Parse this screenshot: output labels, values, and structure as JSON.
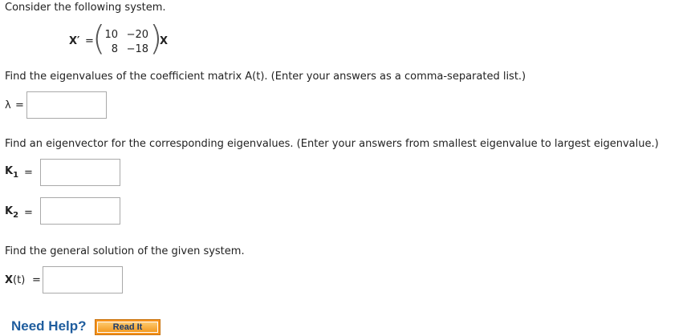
{
  "intro": "Consider the following system.",
  "system": {
    "lhs": "X′",
    "equals": "=",
    "matrix": [
      [
        "10",
        "−20"
      ],
      [
        "8",
        "−18"
      ]
    ],
    "rhs": "X"
  },
  "q1": {
    "prompt": "Find the eigenvalues of the coefficient matrix A(t). (Enter your answers as a comma-separated list.)",
    "label": "λ",
    "equals": "="
  },
  "q2": {
    "prompt": "Find an eigenvector for the corresponding eigenvalues. (Enter your answers from smallest eigenvalue to largest eigenvalue.)",
    "k1_label": "K",
    "k1_sub": "1",
    "k2_label": "K",
    "k2_sub": "2",
    "equals": "="
  },
  "q3": {
    "prompt": "Find the general solution of the given system.",
    "label": "X",
    "label_arg": "(t)",
    "equals": "="
  },
  "help": {
    "need_help": "Need Help?",
    "read_it": "Read It"
  }
}
